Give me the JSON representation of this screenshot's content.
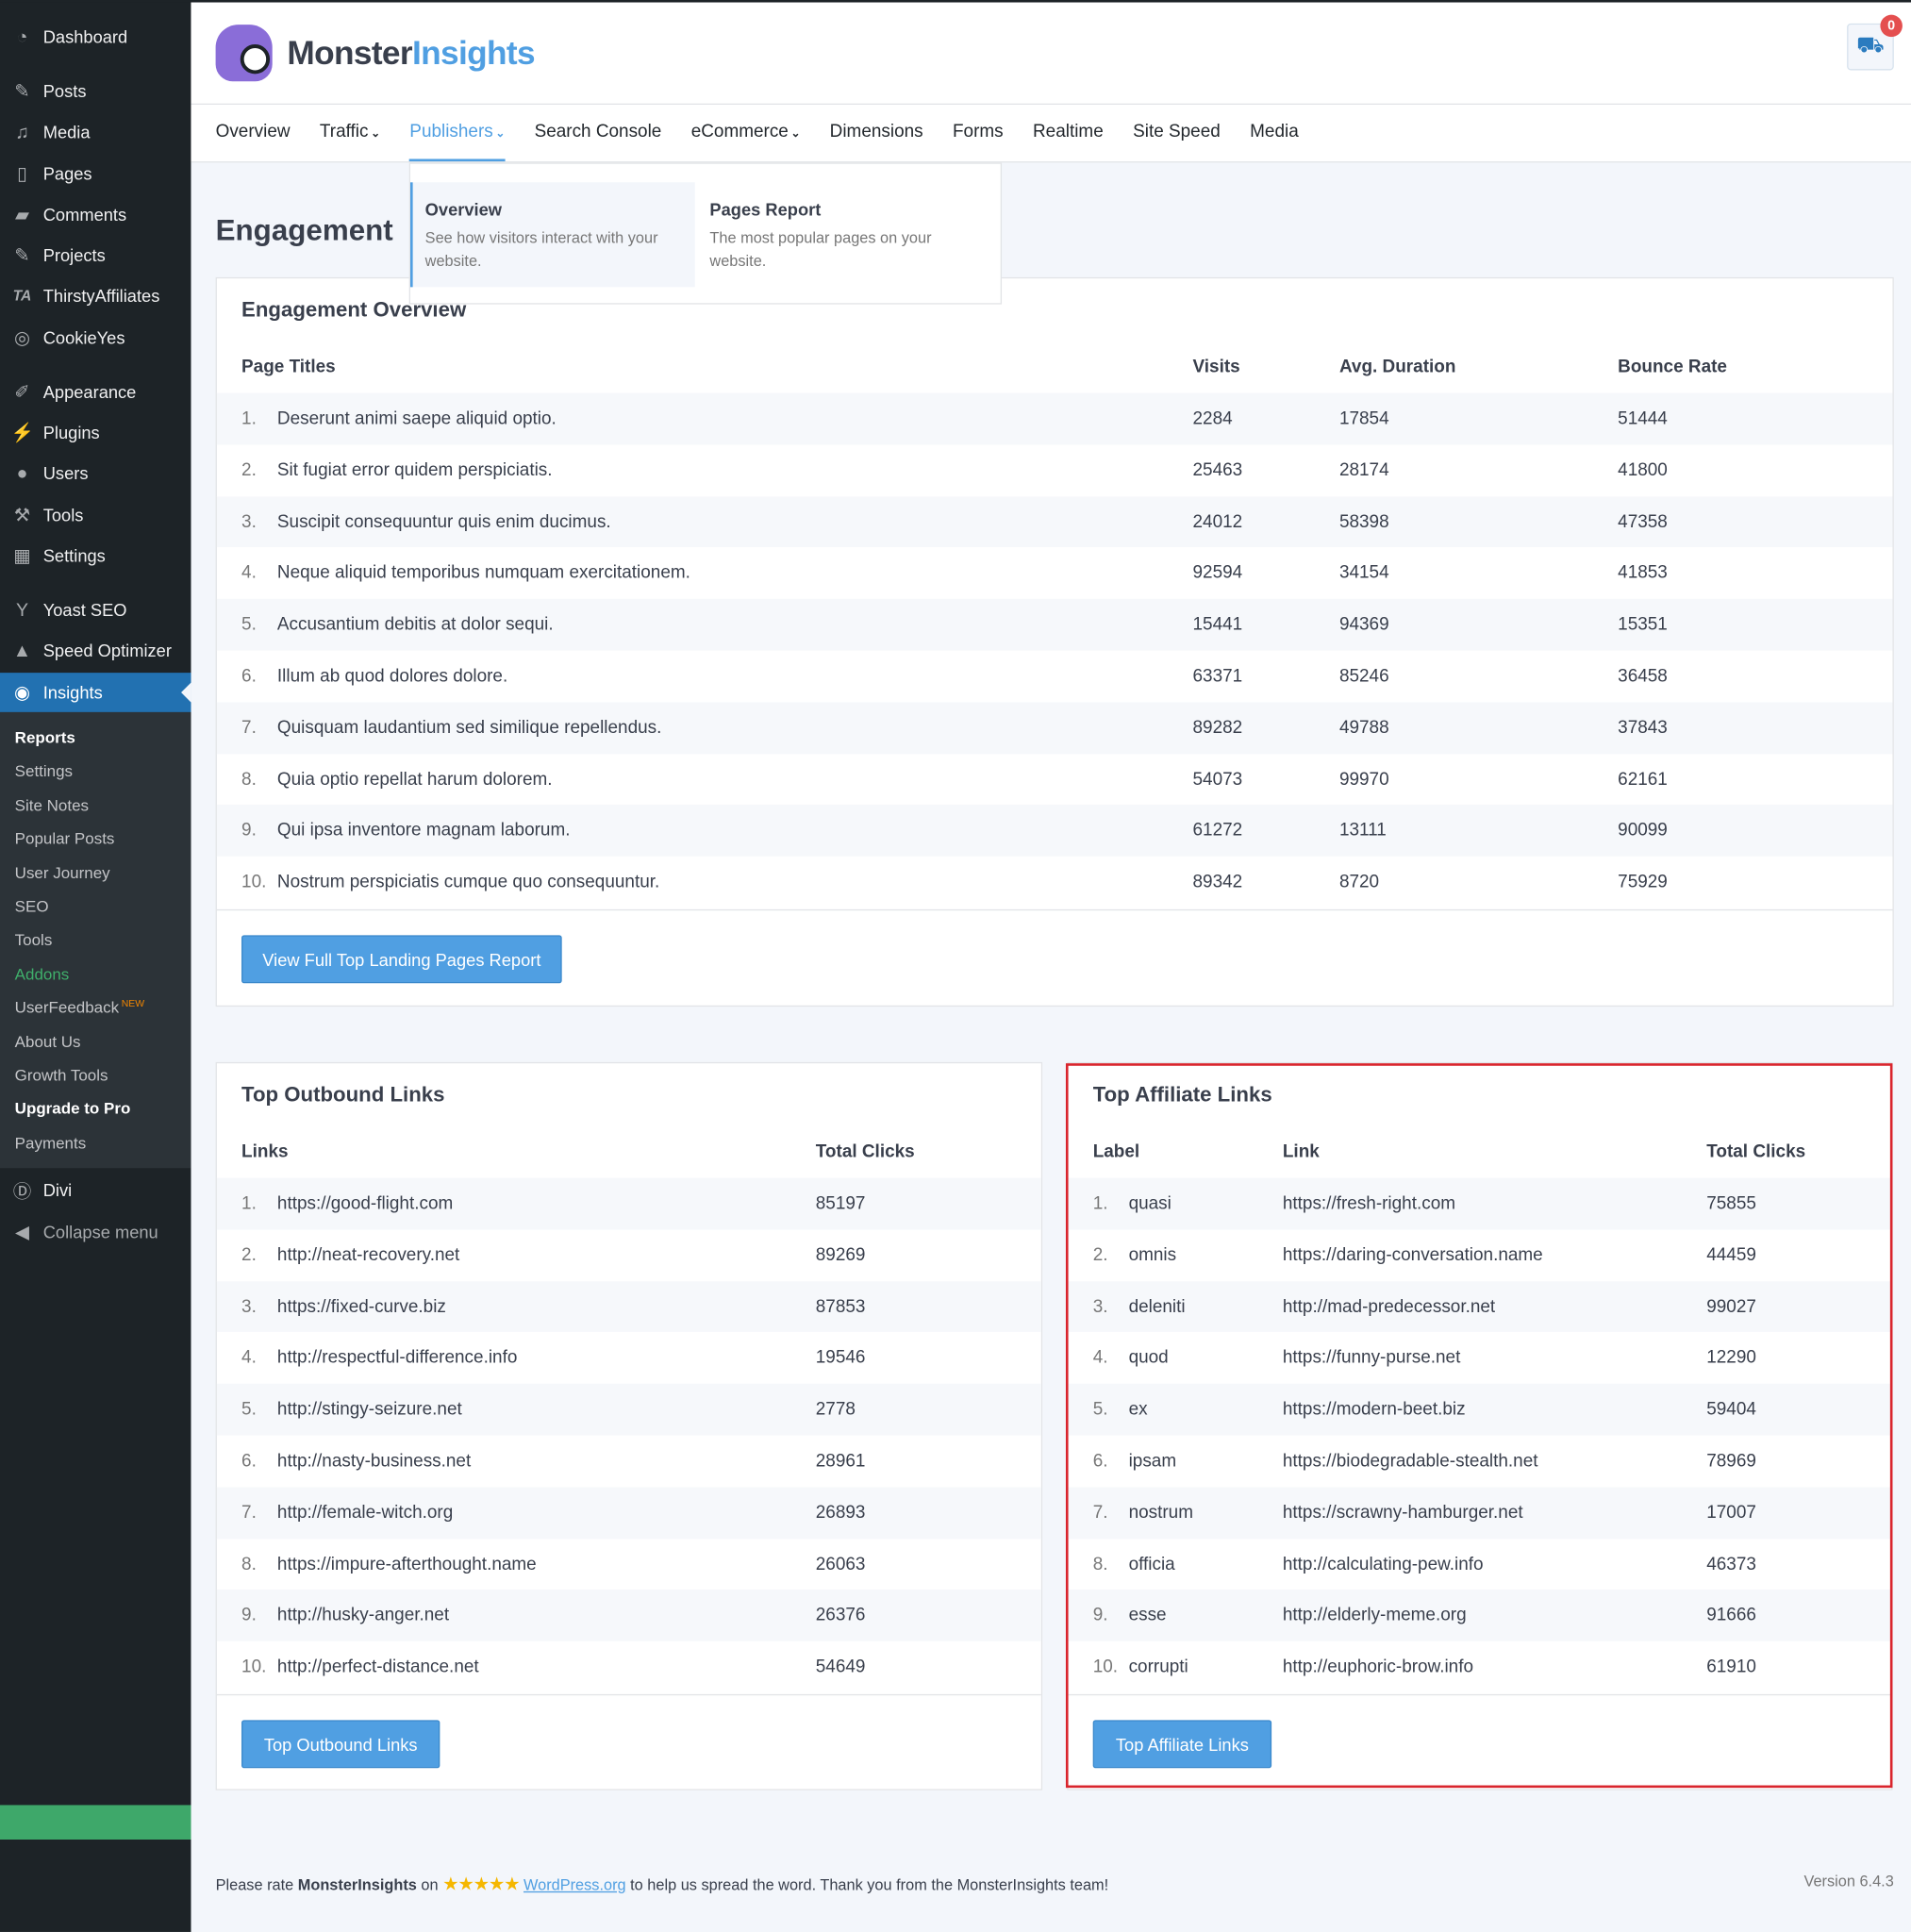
{
  "sidebar": {
    "items": [
      {
        "label": "Dashboard",
        "icon": "dashboard-icon",
        "glyph": "◔"
      },
      {
        "label": "Posts",
        "icon": "pin-icon",
        "glyph": "✎"
      },
      {
        "label": "Media",
        "icon": "media-icon",
        "glyph": "♫"
      },
      {
        "label": "Pages",
        "icon": "pages-icon",
        "glyph": "▯"
      },
      {
        "label": "Comments",
        "icon": "comment-icon",
        "glyph": "▰"
      },
      {
        "label": "Projects",
        "icon": "pin-icon",
        "glyph": "✎"
      },
      {
        "label": "ThirstyAffiliates",
        "icon": "ta-icon",
        "glyph": "TA"
      },
      {
        "label": "CookieYes",
        "icon": "cookie-icon",
        "glyph": "◎"
      },
      {
        "label": "Appearance",
        "icon": "brush-icon",
        "glyph": "✐"
      },
      {
        "label": "Plugins",
        "icon": "plug-icon",
        "glyph": "⚡"
      },
      {
        "label": "Users",
        "icon": "user-icon",
        "glyph": "●"
      },
      {
        "label": "Tools",
        "icon": "wrench-icon",
        "glyph": "⚒"
      },
      {
        "label": "Settings",
        "icon": "settings-icon",
        "glyph": "▦"
      },
      {
        "label": "Yoast SEO",
        "icon": "yoast-icon",
        "glyph": "Y"
      },
      {
        "label": "Speed Optimizer",
        "icon": "speed-icon",
        "glyph": "▲"
      },
      {
        "label": "Insights",
        "icon": "insights-icon",
        "glyph": "◉"
      }
    ],
    "submenu": [
      "Reports",
      "Settings",
      "Site Notes",
      "Popular Posts",
      "User Journey",
      "SEO",
      "Tools",
      "Addons",
      "UserFeedback",
      "About Us",
      "Growth Tools",
      "Upgrade to Pro",
      "Payments"
    ],
    "new_badge": "NEW",
    "divi": "Divi",
    "collapse": "Collapse menu"
  },
  "header": {
    "logo_dark": "Monster",
    "logo_light": "Insights",
    "notifications": "0"
  },
  "nav": [
    {
      "label": "Overview"
    },
    {
      "label": "Traffic",
      "dd": true
    },
    {
      "label": "Publishers",
      "dd": true
    },
    {
      "label": "Search Console"
    },
    {
      "label": "eCommerce",
      "dd": true
    },
    {
      "label": "Dimensions"
    },
    {
      "label": "Forms"
    },
    {
      "label": "Realtime"
    },
    {
      "label": "Site Speed"
    },
    {
      "label": "Media"
    }
  ],
  "dropdown": [
    {
      "title": "Overview",
      "desc": "See how visitors interact with your website."
    },
    {
      "title": "Pages Report",
      "desc": "The most popular pages on your website."
    }
  ],
  "page_title": "Engagement",
  "engagement": {
    "title": "Engagement Overview",
    "headers": [
      "Page Titles",
      "Visits",
      "Avg. Duration",
      "Bounce Rate"
    ],
    "rows": [
      [
        "Deserunt animi saepe aliquid optio.",
        "2284",
        "17854",
        "51444"
      ],
      [
        "Sit fugiat error quidem perspiciatis.",
        "25463",
        "28174",
        "41800"
      ],
      [
        "Suscipit consequuntur quis enim ducimus.",
        "24012",
        "58398",
        "47358"
      ],
      [
        "Neque aliquid temporibus numquam exercitationem.",
        "92594",
        "34154",
        "41853"
      ],
      [
        "Accusantium debitis at dolor sequi.",
        "15441",
        "94369",
        "15351"
      ],
      [
        "Illum ab quod dolores dolore.",
        "63371",
        "85246",
        "36458"
      ],
      [
        "Quisquam laudantium sed similique repellendus.",
        "89282",
        "49788",
        "37843"
      ],
      [
        "Quia optio repellat harum dolorem.",
        "54073",
        "99970",
        "62161"
      ],
      [
        "Qui ipsa inventore magnam laborum.",
        "61272",
        "13111",
        "90099"
      ],
      [
        "Nostrum perspiciatis cumque quo consequuntur.",
        "89342",
        "8720",
        "75929"
      ]
    ],
    "button": "View Full Top Landing Pages Report"
  },
  "outbound": {
    "title": "Top Outbound Links",
    "headers": [
      "Links",
      "Total Clicks"
    ],
    "rows": [
      [
        "https://good-flight.com",
        "85197"
      ],
      [
        "http://neat-recovery.net",
        "89269"
      ],
      [
        "https://fixed-curve.biz",
        "87853"
      ],
      [
        "http://respectful-difference.info",
        "19546"
      ],
      [
        "http://stingy-seizure.net",
        "2778"
      ],
      [
        "http://nasty-business.net",
        "28961"
      ],
      [
        "http://female-witch.org",
        "26893"
      ],
      [
        "https://impure-afterthought.name",
        "26063"
      ],
      [
        "http://husky-anger.net",
        "26376"
      ],
      [
        "http://perfect-distance.net",
        "54649"
      ]
    ],
    "button": "Top Outbound Links"
  },
  "affiliate": {
    "title": "Top Affiliate Links",
    "headers": [
      "Label",
      "Link",
      "Total Clicks"
    ],
    "rows": [
      [
        "quasi",
        "https://fresh-right.com",
        "75855"
      ],
      [
        "omnis",
        "https://daring-conversation.name",
        "44459"
      ],
      [
        "deleniti",
        "http://mad-predecessor.net",
        "99027"
      ],
      [
        "quod",
        "https://funny-purse.net",
        "12290"
      ],
      [
        "ex",
        "https://modern-beet.biz",
        "59404"
      ],
      [
        "ipsam",
        "https://biodegradable-stealth.net",
        "78969"
      ],
      [
        "nostrum",
        "https://scrawny-hamburger.net",
        "17007"
      ],
      [
        "officia",
        "http://calculating-pew.info",
        "46373"
      ],
      [
        "esse",
        "http://elderly-meme.org",
        "91666"
      ],
      [
        "corrupti",
        "http://euphoric-brow.info",
        "61910"
      ]
    ],
    "button": "Top Affiliate Links"
  },
  "footer": {
    "pre": "Please rate ",
    "brand": "MonsterInsights",
    "on": " on ",
    "stars": "★★★★★",
    "link": "WordPress.org",
    "post": " to help us spread the word. Thank you from the MonsterInsights team!",
    "version": "Version 6.4.3"
  }
}
